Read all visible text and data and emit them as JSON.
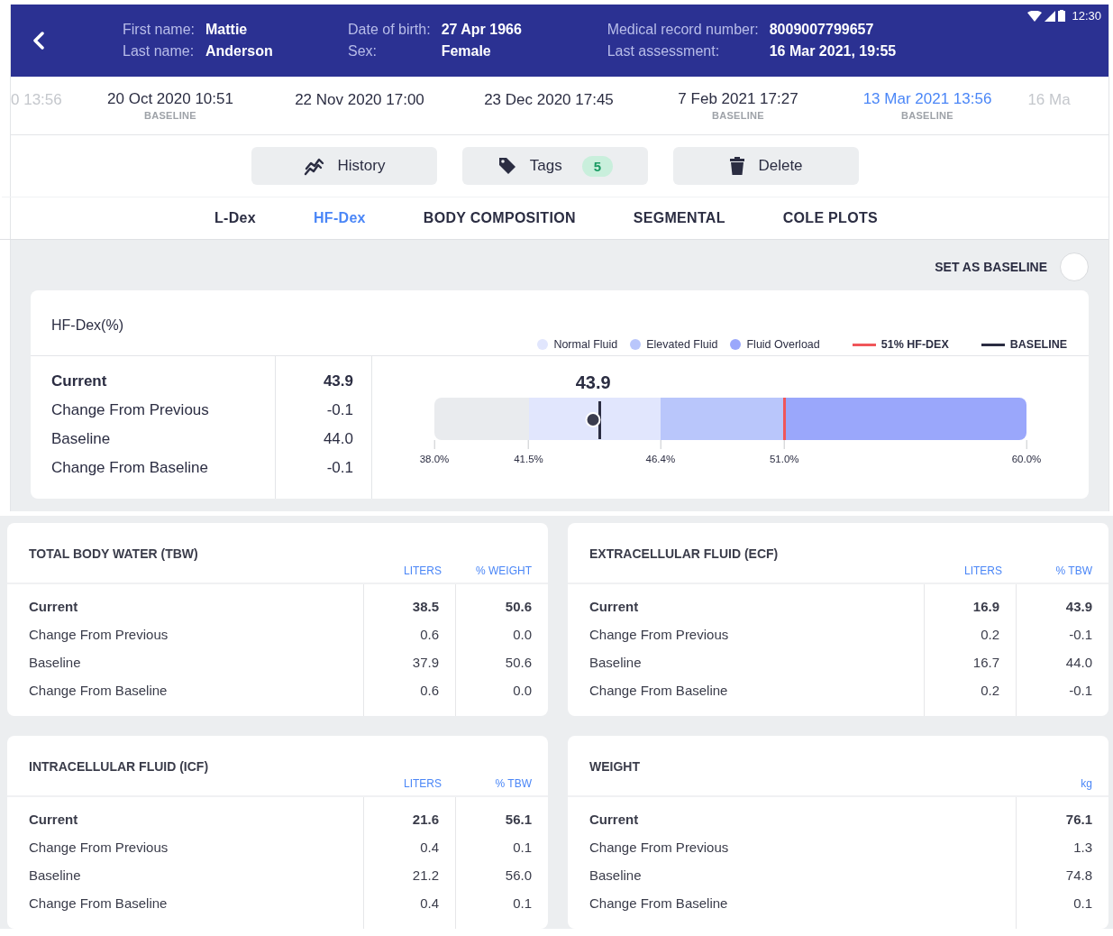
{
  "status_bar": {
    "time": "12:30"
  },
  "patient": {
    "fields": [
      {
        "label": "First name:",
        "value": "Mattie"
      },
      {
        "label": "Last name:",
        "value": "Anderson"
      },
      {
        "label": "Date of birth:",
        "value": "27 Apr 1966"
      },
      {
        "label": "Sex:",
        "value": "Female"
      },
      {
        "label": "Medical record number:",
        "value": "8009007799657"
      },
      {
        "label": "Last assessment:",
        "value": "16 Mar 2021, 19:55"
      }
    ]
  },
  "timeline": [
    {
      "date": "0 13:56",
      "selected": false,
      "faded": true
    },
    {
      "date": "20 Oct 2020 10:51",
      "sublabel": "BASELINE",
      "selected": false,
      "faded": false
    },
    {
      "date": "22 Nov 2020 17:00",
      "selected": false,
      "faded": false
    },
    {
      "date": "23 Dec 2020 17:45",
      "selected": false,
      "faded": false
    },
    {
      "date": "7 Feb 2021 17:27",
      "sublabel": "BASELINE",
      "selected": false,
      "faded": false
    },
    {
      "date": "13 Mar 2021 13:56",
      "sublabel": "BASELINE",
      "selected": true,
      "faded": false
    },
    {
      "date": "16 Ma",
      "selected": false,
      "faded": true
    }
  ],
  "actions": [
    {
      "kind": "history",
      "label": "History"
    },
    {
      "kind": "tags",
      "label": "Tags",
      "badge": "5"
    },
    {
      "kind": "delete",
      "label": "Delete"
    }
  ],
  "tabs": [
    {
      "label": "L-Dex",
      "selected": false
    },
    {
      "label": "HF-Dex",
      "selected": true
    },
    {
      "label": "BODY COMPOSITION",
      "selected": false
    },
    {
      "label": "SEGMENTAL",
      "selected": false
    },
    {
      "label": "COLE PLOTS",
      "selected": false
    }
  ],
  "baseline_toggle": {
    "label": "SET AS BASELINE",
    "checked": false
  },
  "hfdex": {
    "title": "HF-Dex(%)",
    "legend": [
      {
        "kind": "dot",
        "label": "Normal Fluid",
        "color": "#e1e6fd"
      },
      {
        "kind": "dot",
        "label": "Elevated Fluid",
        "color": "#b9c6fb"
      },
      {
        "kind": "dot",
        "label": "Fluid Overload",
        "color": "#9aa7fb"
      },
      {
        "kind": "line",
        "label": "51% HF-DEX",
        "color": "#f0565a"
      },
      {
        "kind": "line",
        "label": "BASELINE",
        "color": "#2b2d42"
      }
    ],
    "rows": [
      {
        "label": "Current",
        "value": "43.9"
      },
      {
        "label": "Change From Previous",
        "value": "-0.1"
      },
      {
        "label": "Baseline",
        "value": "44.0"
      },
      {
        "label": "Change From Baseline",
        "value": "-0.1"
      }
    ],
    "gauge": {
      "current": "43.9",
      "ticks": [
        "38.0%",
        "41.5%",
        "46.4%",
        "51.0%",
        "60.0%"
      ],
      "segments": [
        {
          "color": "#e9ebee"
        },
        {
          "color": "#e1e6fd"
        },
        {
          "color": "#b9c6fb"
        },
        {
          "color": "#9aa7fb"
        }
      ]
    }
  },
  "cards": [
    {
      "title": "TOTAL BODY WATER (TBW)",
      "columns": [
        "LITERS",
        "% WEIGHT"
      ],
      "rows": [
        {
          "label": "Current",
          "values": [
            "38.5",
            "50.6"
          ]
        },
        {
          "label": "Change From Previous",
          "values": [
            "0.6",
            "0.0"
          ]
        },
        {
          "label": "Baseline",
          "values": [
            "37.9",
            "50.6"
          ]
        },
        {
          "label": "Change From Baseline",
          "values": [
            "0.6",
            "0.0"
          ]
        }
      ]
    },
    {
      "title": "EXTRACELLULAR FLUID (ECF)",
      "columns": [
        "LITERS",
        "% TBW"
      ],
      "rows": [
        {
          "label": "Current",
          "values": [
            "16.9",
            "43.9"
          ]
        },
        {
          "label": "Change From Previous",
          "values": [
            "0.2",
            "-0.1"
          ]
        },
        {
          "label": "Baseline",
          "values": [
            "16.7",
            "44.0"
          ]
        },
        {
          "label": "Change From Baseline",
          "values": [
            "0.2",
            "-0.1"
          ]
        }
      ]
    },
    {
      "title": "INTRACELLULAR FLUID (ICF)",
      "columns": [
        "LITERS",
        "% TBW"
      ],
      "rows": [
        {
          "label": "Current",
          "values": [
            "21.6",
            "56.1"
          ]
        },
        {
          "label": "Change From Previous",
          "values": [
            "0.4",
            "0.1"
          ]
        },
        {
          "label": "Baseline",
          "values": [
            "21.2",
            "56.0"
          ]
        },
        {
          "label": "Change From Baseline",
          "values": [
            "0.4",
            "0.1"
          ]
        }
      ]
    },
    {
      "title": "WEIGHT",
      "columns": [
        "kg"
      ],
      "rows": [
        {
          "label": "Current",
          "values": [
            "76.1"
          ]
        },
        {
          "label": "Change From Previous",
          "values": [
            "1.3"
          ]
        },
        {
          "label": "Baseline",
          "values": [
            "74.8"
          ]
        },
        {
          "label": "Change From Baseline",
          "values": [
            "0.1"
          ]
        }
      ]
    }
  ]
}
